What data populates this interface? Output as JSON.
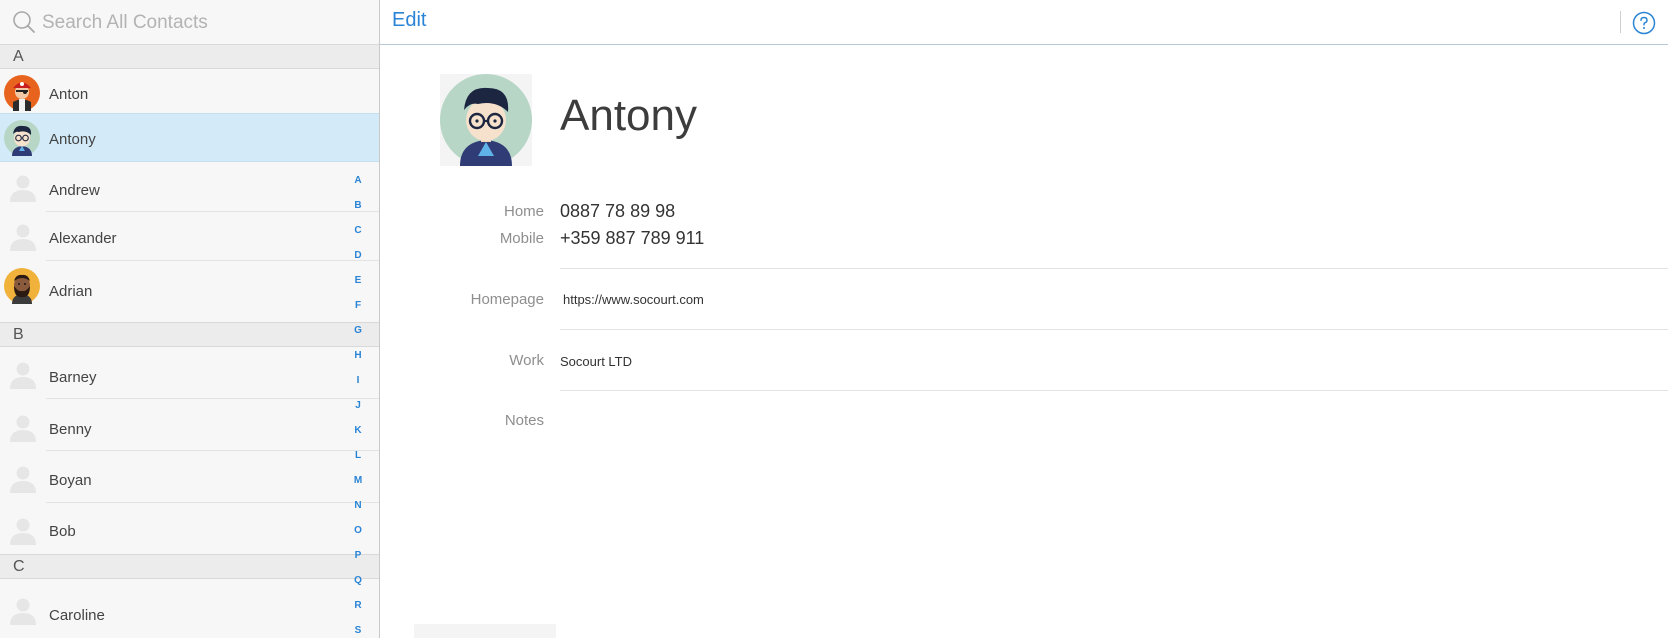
{
  "search": {
    "placeholder": "Search All Contacts"
  },
  "contacts": {
    "sections": [
      "A",
      "B",
      "C"
    ],
    "a_items": [
      {
        "name": "Anton",
        "avatar": "pirate-avatar"
      },
      {
        "name": "Antony",
        "avatar": "glasses-boy-avatar",
        "selected": true
      },
      {
        "name": "Andrew",
        "avatar": "placeholder-avatar"
      },
      {
        "name": "Alexander",
        "avatar": "placeholder-avatar"
      },
      {
        "name": "Adrian",
        "avatar": "bearded-man-avatar"
      }
    ],
    "b_items": [
      {
        "name": "Barney",
        "avatar": "placeholder-avatar"
      },
      {
        "name": "Benny",
        "avatar": "placeholder-avatar"
      },
      {
        "name": "Boyan",
        "avatar": "placeholder-avatar"
      },
      {
        "name": "Bob",
        "avatar": "placeholder-avatar"
      }
    ],
    "c_items": [
      {
        "name": "Caroline",
        "avatar": "placeholder-avatar"
      }
    ]
  },
  "index_letters": [
    "A",
    "B",
    "C",
    "D",
    "E",
    "F",
    "G",
    "H",
    "I",
    "J",
    "K",
    "L",
    "M",
    "N",
    "O",
    "P",
    "Q",
    "R",
    "S"
  ],
  "toolbar": {
    "edit_label": "Edit",
    "help_icon": "question-circle-icon"
  },
  "detail": {
    "name": "Antony",
    "fields": [
      {
        "label": "Home",
        "value": "0887 78 89 98"
      },
      {
        "label": "Mobile",
        "value": "+359 887 789 911"
      },
      {
        "label": "Homepage",
        "value": "https://www.socourt.com"
      },
      {
        "label": "Work",
        "value": "Socourt LTD"
      },
      {
        "label": "Notes",
        "value": ""
      }
    ]
  },
  "colors": {
    "accent": "#2a84d6",
    "selected_row": "#d3ebf8",
    "section_bg": "#ececec"
  }
}
